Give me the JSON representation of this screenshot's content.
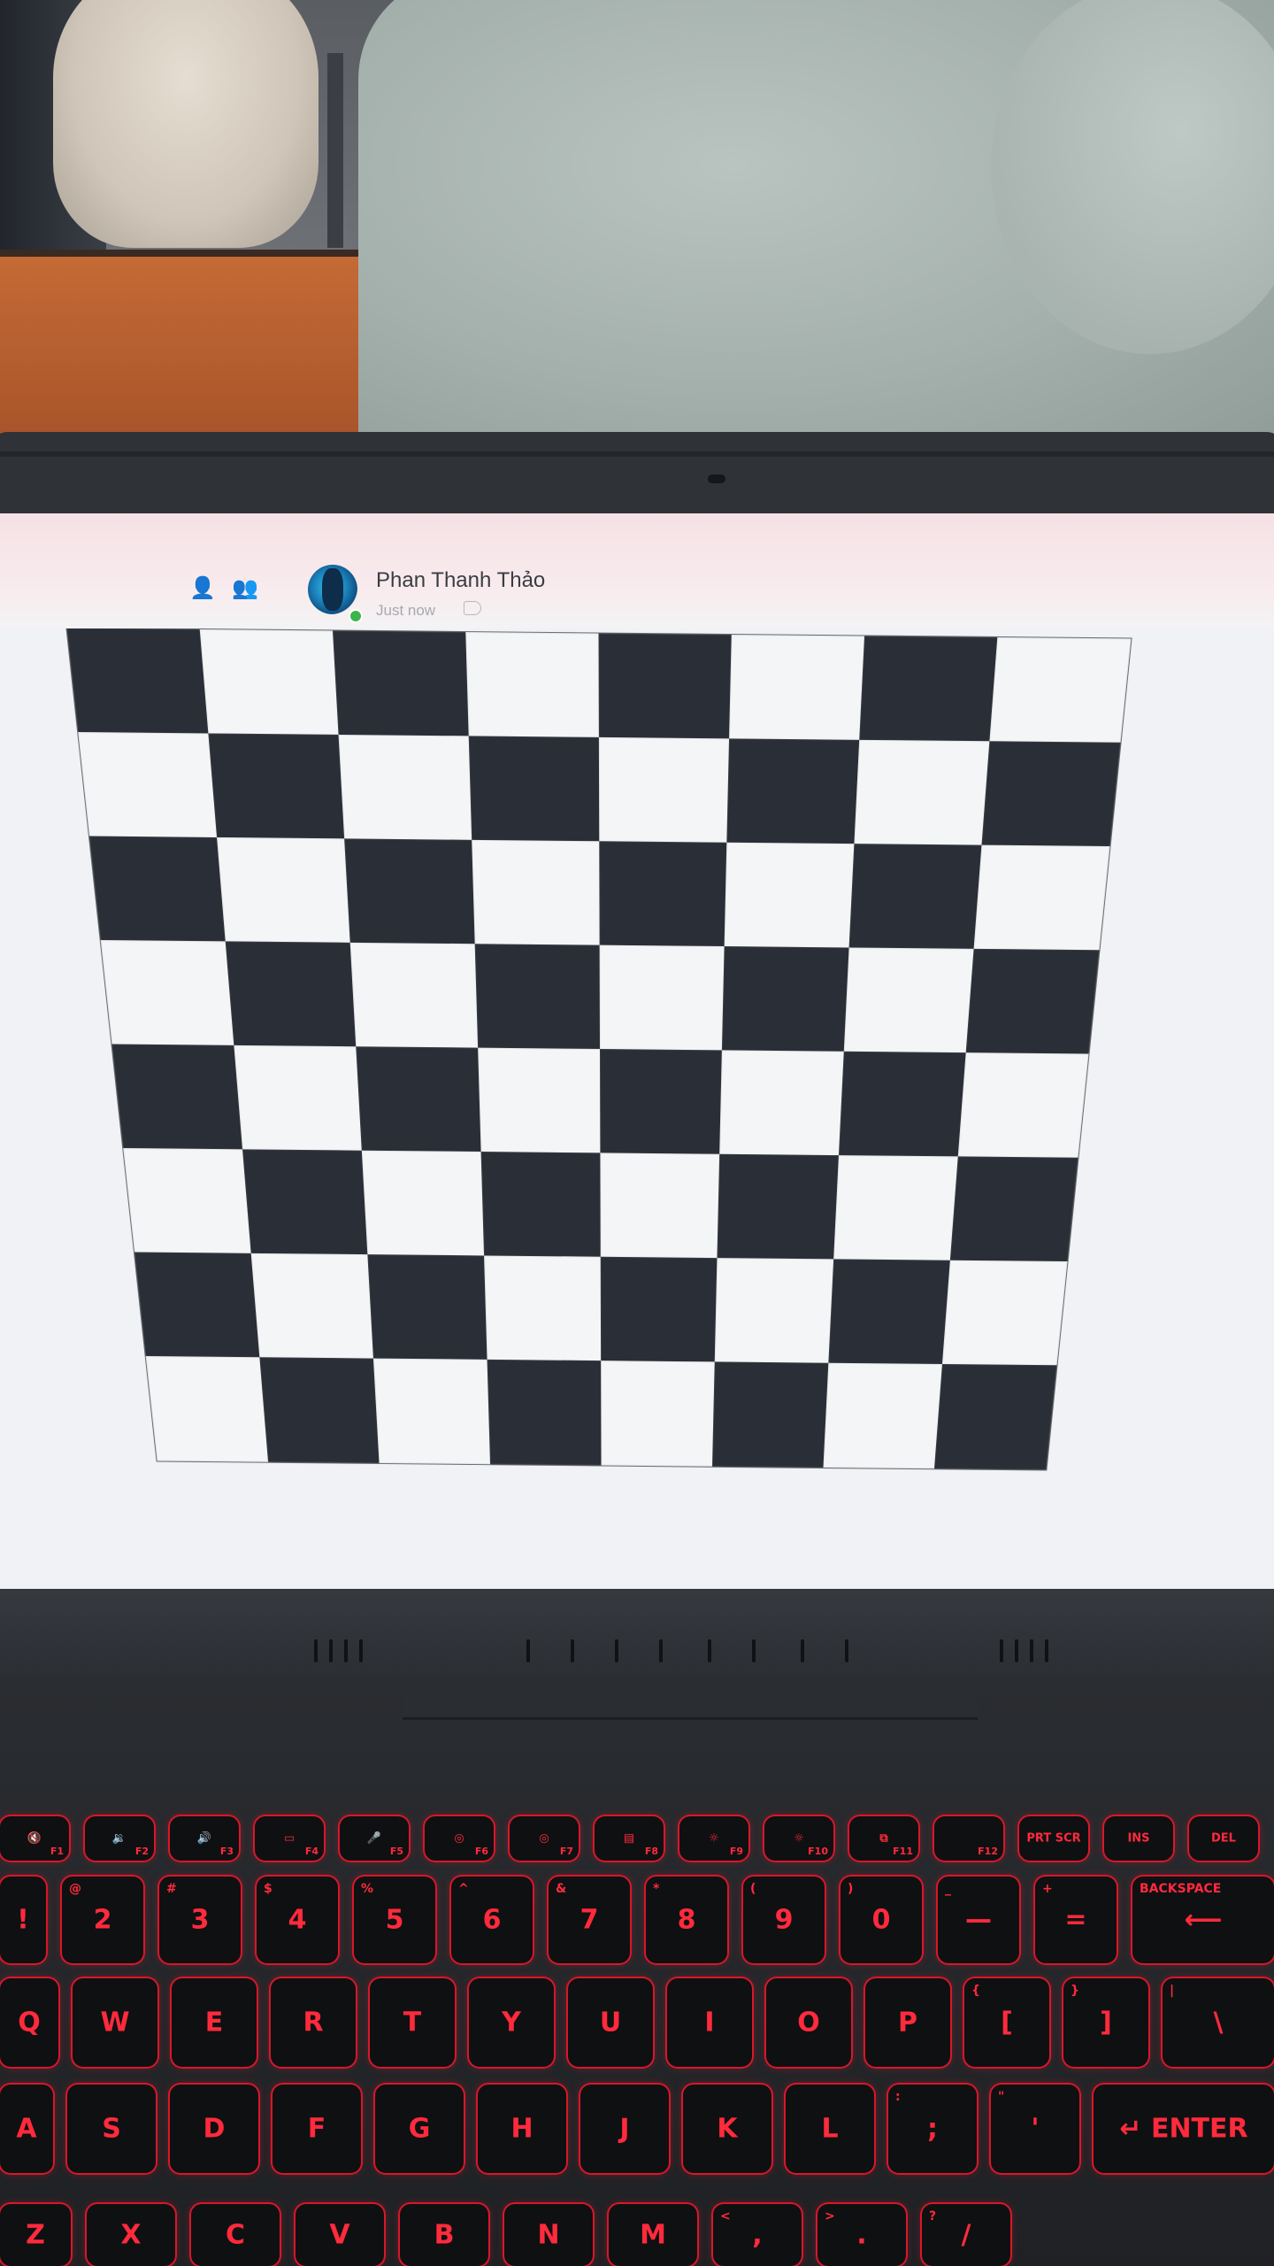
{
  "chat": {
    "sender_name": "Phan Thanh Thảo",
    "timestamp": "Just now",
    "icons": {
      "add_person": "add-person-icon",
      "group": "group-icon",
      "tag": "tag-icon",
      "presence": "online-status-icon"
    }
  },
  "image": {
    "description_type": "checkerboard",
    "rows": 8,
    "cols": 8,
    "dark_color": "#2a2e36",
    "light_color": "#f4f5f7"
  },
  "keyboard": {
    "function_row": [
      {
        "main": "🔇",
        "sub": "F1"
      },
      {
        "main": "🔉",
        "sub": "F2"
      },
      {
        "main": "🔊",
        "sub": "F3"
      },
      {
        "main": "▭",
        "sub": "F4"
      },
      {
        "main": "🎤",
        "sub": "F5"
      },
      {
        "main": "◎",
        "sub": "F6"
      },
      {
        "main": "◎",
        "sub": "F7"
      },
      {
        "main": "▤",
        "sub": "F8"
      },
      {
        "main": "☼",
        "sub": "F9"
      },
      {
        "main": "☼",
        "sub": "F10"
      },
      {
        "main": "⧉",
        "sub": "F11"
      },
      {
        "main": "",
        "sub": "F12"
      },
      {
        "main": "PRT SCR",
        "sub": ""
      },
      {
        "main": "INS",
        "sub": ""
      },
      {
        "main": "DEL",
        "sub": ""
      }
    ],
    "number_row": [
      {
        "main": "!",
        "sub": ""
      },
      {
        "main": "2",
        "sub": "@"
      },
      {
        "main": "3",
        "sub": "#"
      },
      {
        "main": "4",
        "sub": "$"
      },
      {
        "main": "5",
        "sub": "%"
      },
      {
        "main": "6",
        "sub": "^"
      },
      {
        "main": "7",
        "sub": "&"
      },
      {
        "main": "8",
        "sub": "*"
      },
      {
        "main": "9",
        "sub": "("
      },
      {
        "main": "0",
        "sub": ")"
      },
      {
        "main": "—",
        "sub": "_"
      },
      {
        "main": "=",
        "sub": "+"
      },
      {
        "main": "⟵",
        "sub": "BACKSPACE"
      }
    ],
    "qwerty_row": [
      {
        "main": "Q",
        "sub": ""
      },
      {
        "main": "W",
        "sub": ""
      },
      {
        "main": "E",
        "sub": ""
      },
      {
        "main": "R",
        "sub": ""
      },
      {
        "main": "T",
        "sub": ""
      },
      {
        "main": "Y",
        "sub": ""
      },
      {
        "main": "U",
        "sub": ""
      },
      {
        "main": "I",
        "sub": ""
      },
      {
        "main": "O",
        "sub": ""
      },
      {
        "main": "P",
        "sub": ""
      },
      {
        "main": "[",
        "sub": "{"
      },
      {
        "main": "]",
        "sub": "}"
      },
      {
        "main": "\\",
        "sub": "|"
      }
    ],
    "home_row": [
      {
        "main": "A",
        "sub": ""
      },
      {
        "main": "S",
        "sub": ""
      },
      {
        "main": "D",
        "sub": ""
      },
      {
        "main": "F",
        "sub": ""
      },
      {
        "main": "G",
        "sub": ""
      },
      {
        "main": "H",
        "sub": ""
      },
      {
        "main": "J",
        "sub": ""
      },
      {
        "main": "K",
        "sub": ""
      },
      {
        "main": "L",
        "sub": ""
      },
      {
        "main": ";",
        "sub": ":"
      },
      {
        "main": "'",
        "sub": "\""
      },
      {
        "main": "↵ ENTER",
        "sub": ""
      }
    ],
    "bottom_row": [
      {
        "main": "Z",
        "sub": ""
      },
      {
        "main": "X",
        "sub": ""
      },
      {
        "main": "C",
        "sub": ""
      },
      {
        "main": "V",
        "sub": ""
      },
      {
        "main": "B",
        "sub": ""
      },
      {
        "main": "N",
        "sub": ""
      },
      {
        "main": "M",
        "sub": ""
      },
      {
        "main": ",",
        "sub": "<"
      },
      {
        "main": ".",
        "sub": ">"
      },
      {
        "main": "/",
        "sub": "?"
      }
    ]
  }
}
